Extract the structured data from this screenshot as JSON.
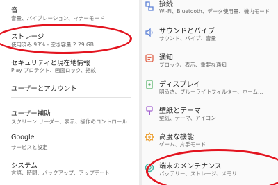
{
  "left": {
    "items": [
      {
        "title": "音",
        "subtitle": "音量、バイブレーション、マナーモード"
      },
      {
        "title": "ストレージ",
        "subtitle": "使用済み 93% - 空き容量 2.29 GB"
      },
      {
        "title": "セキュリティと現在地情報",
        "subtitle": "Play プロテクト、画面ロック、指紋"
      },
      {
        "title": "ユーザーとアカウント",
        "subtitle": ""
      },
      {
        "title": "ユーザー補助",
        "subtitle": "スクリーン リーダー、表示、操作のコントロール"
      },
      {
        "title": "Google",
        "subtitle": "サービスと設定"
      },
      {
        "title": "システム",
        "subtitle": "言語、時間、バックアップ、アップデート"
      }
    ]
  },
  "right": {
    "items": [
      {
        "title": "接続",
        "subtitle": "Wi-Fi、Bluetooth、データ使用量、機内モード",
        "icon": "link-icon"
      },
      {
        "title": "サウンドとバイブ",
        "subtitle": "サウンド、バイブ、音量",
        "icon": "speaker-icon"
      },
      {
        "title": "通知",
        "subtitle": "ブロック、表示、重要な通知",
        "icon": "notification-icon"
      },
      {
        "title": "ディスプレイ",
        "subtitle": "明るさ、ブルーライトフィルター、ホーム…",
        "icon": "display-icon"
      },
      {
        "title": "壁紙とテーマ",
        "subtitle": "壁紙、テーマ、アイコン",
        "icon": "paintbrush-icon"
      },
      {
        "title": "高度な機能",
        "subtitle": "ゲーム、片手モード",
        "icon": "gear-plus-icon"
      },
      {
        "title": "端末のメンテナンス",
        "subtitle": "バッテリー、ストレージ、メモリ",
        "icon": "device-care-icon"
      }
    ]
  },
  "colors": {
    "highlight": "#e3141f",
    "icon_blue": "#5a7fd6",
    "icon_red": "#e0634a",
    "icon_green": "#57b36a",
    "icon_purple": "#a262d0",
    "icon_orange": "#eb9d2b",
    "icon_teal": "#3ab2a0"
  }
}
